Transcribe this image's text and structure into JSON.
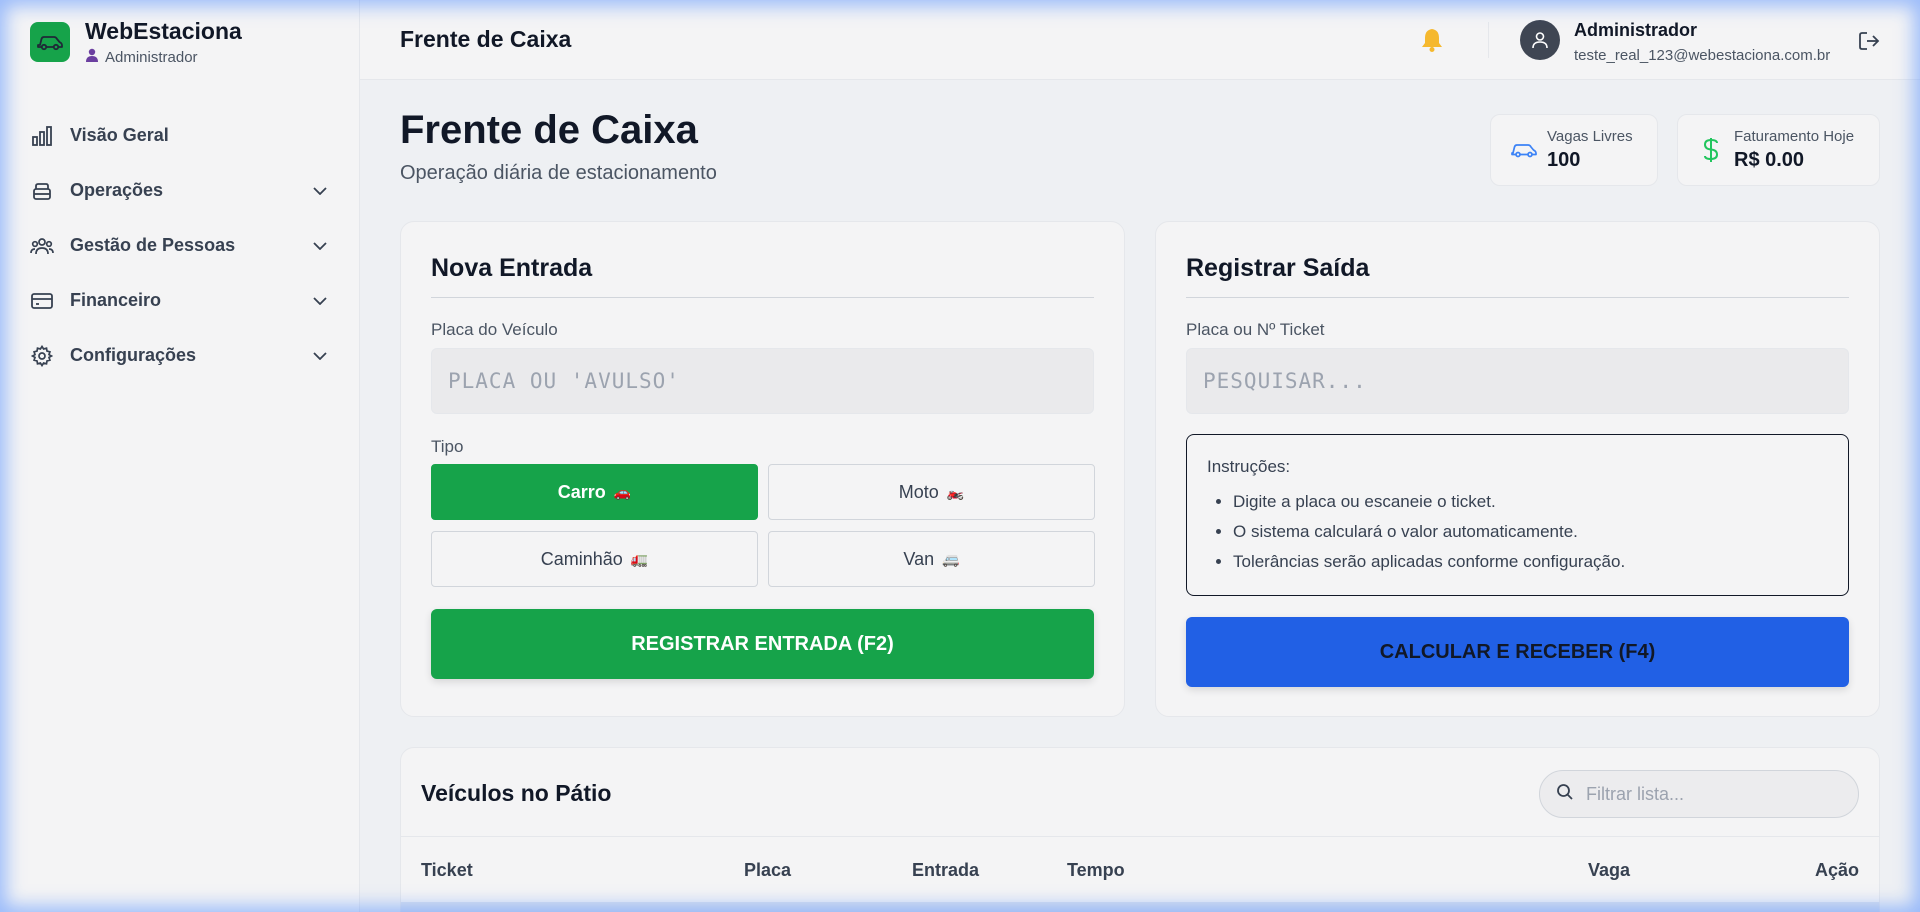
{
  "brand": {
    "name": "WebEstaciona",
    "role": "Administrador",
    "icon": "car-icon"
  },
  "nav": [
    {
      "label": "Visão Geral",
      "icon": "chart-bar-icon",
      "expandable": false
    },
    {
      "label": "Operações",
      "icon": "layers-icon",
      "expandable": true
    },
    {
      "label": "Gestão de Pessoas",
      "icon": "users-icon",
      "expandable": true
    },
    {
      "label": "Financeiro",
      "icon": "card-icon",
      "expandable": true
    },
    {
      "label": "Configurações",
      "icon": "gear-icon",
      "expandable": true
    }
  ],
  "header": {
    "title": "Frente de Caixa",
    "user_name": "Administrador",
    "user_email": "teste_real_123@webestaciona.com.br"
  },
  "page": {
    "title": "Frente de Caixa",
    "subtitle": "Operação diária de estacionamento"
  },
  "stats": {
    "vagas_label": "Vagas Livres",
    "vagas_value": "100",
    "faturamento_label": "Faturamento Hoje",
    "faturamento_value": "R$ 0.00"
  },
  "entrada": {
    "title": "Nova Entrada",
    "placa_label": "Placa do Veículo",
    "placa_placeholder": "PLACA OU 'AVULSO'",
    "tipo_label": "Tipo",
    "types": [
      {
        "label": "Carro",
        "emoji": "🚗",
        "selected": true
      },
      {
        "label": "Moto",
        "emoji": "🏍️",
        "selected": false
      },
      {
        "label": "Caminhão",
        "emoji": "🚛",
        "selected": false
      },
      {
        "label": "Van",
        "emoji": "🚐",
        "selected": false
      }
    ],
    "button_label": "REGISTRAR ENTRADA (F2)"
  },
  "saida": {
    "title": "Registrar Saída",
    "search_label": "Placa ou Nº Ticket",
    "search_placeholder": "PESQUISAR...",
    "instructions_title": "Instruções:",
    "instructions": [
      "Digite a placa ou escaneie o ticket.",
      "O sistema calculará o valor automaticamente.",
      "Tolerâncias serão aplicadas conforme configuração."
    ],
    "button_label": "CALCULAR E RECEBER (F4)"
  },
  "patio": {
    "title": "Veículos no Pátio",
    "filter_placeholder": "Filtrar lista...",
    "columns": [
      "Ticket",
      "Placa",
      "Entrada",
      "Tempo",
      "Vaga",
      "Ação"
    ]
  },
  "colors": {
    "accent_green": "#16a34a",
    "accent_blue": "#2160e5"
  }
}
